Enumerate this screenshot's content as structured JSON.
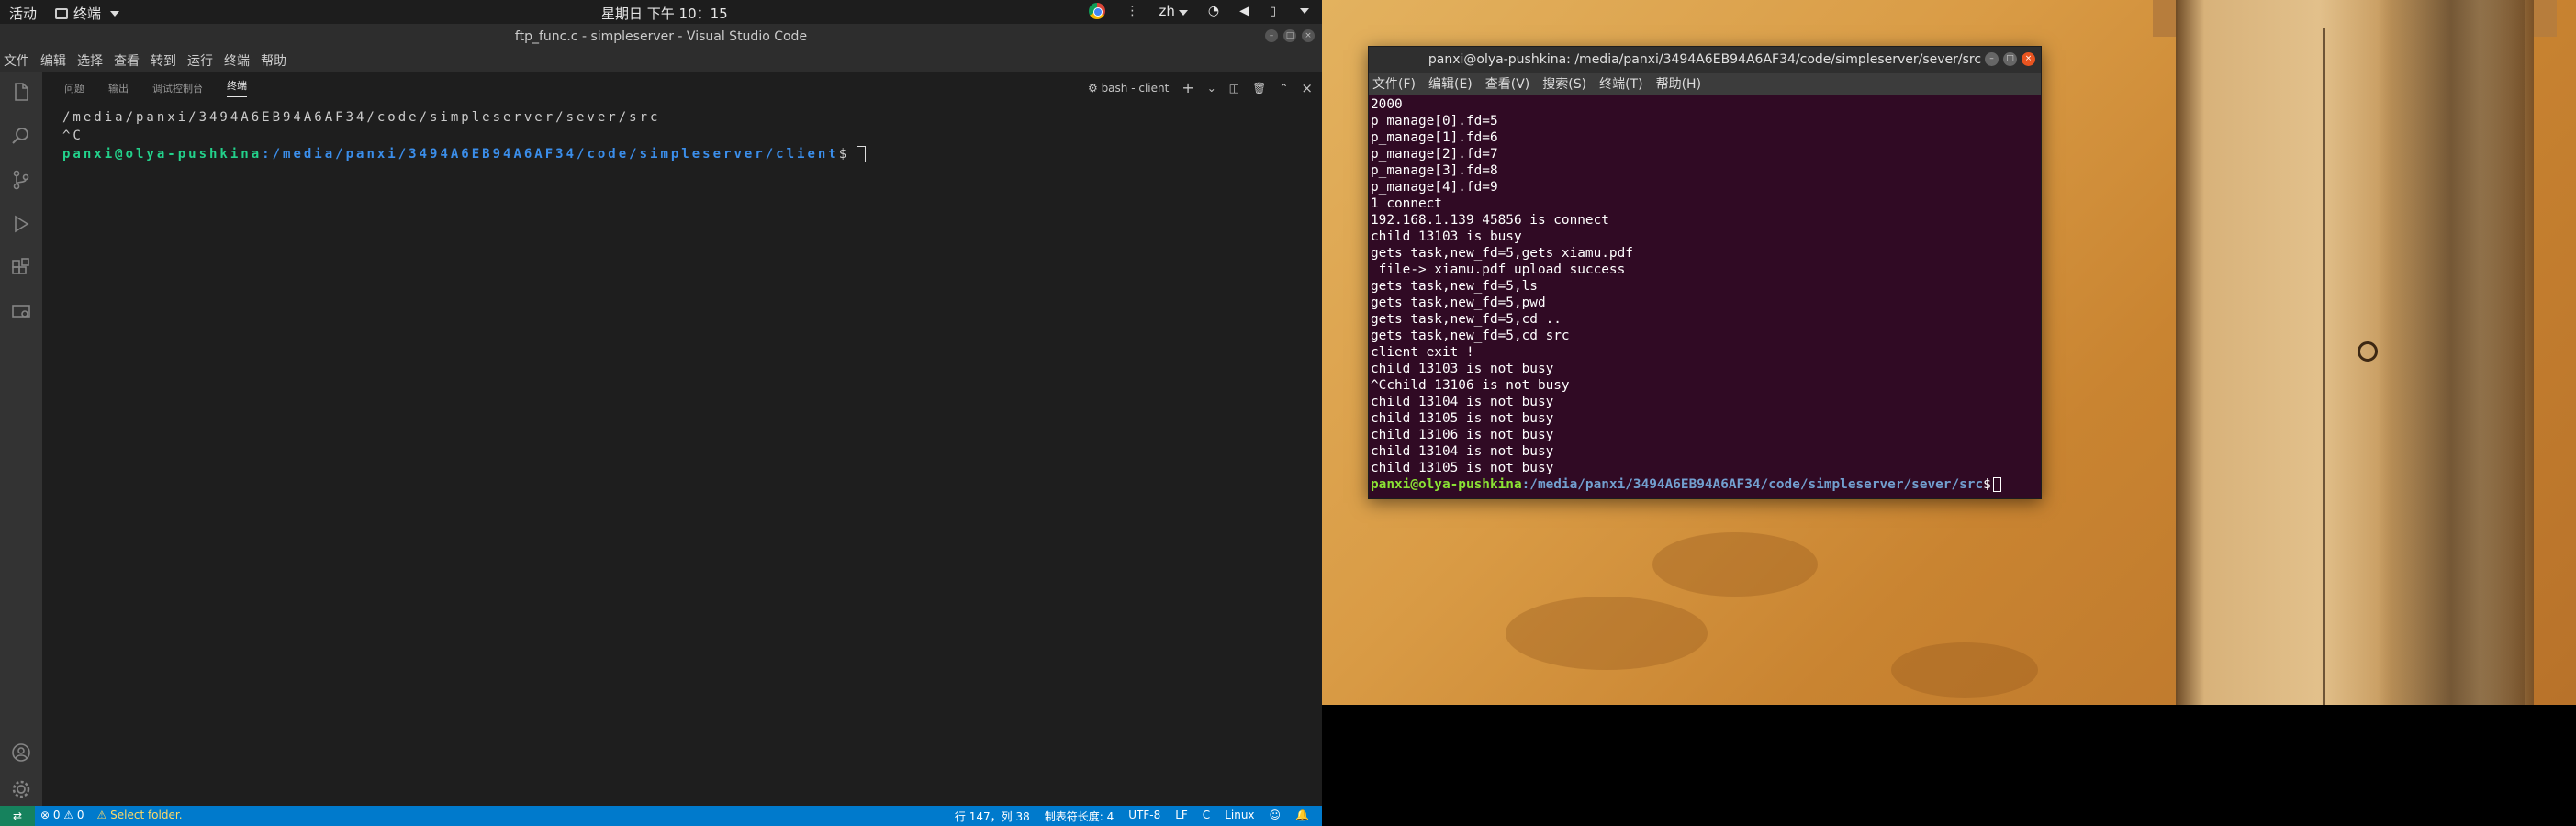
{
  "topbar": {
    "activities": "活动",
    "app_menu": "终端",
    "clock": "星期日 下午 10：15",
    "lang": "zh"
  },
  "vscode": {
    "title": "ftp_func.c - simpleserver - Visual Studio Code",
    "menu": [
      "文件",
      "编辑",
      "选择",
      "查看",
      "转到",
      "运行",
      "终端",
      "帮助"
    ],
    "panel_tabs": [
      "问题",
      "输出",
      "调试控制台",
      "终端"
    ],
    "active_tab": "终端",
    "terminal_selector": "bash - client",
    "terminal_lines": {
      "line1": "/media/panxi/3494A6EB94A6AF34/code/simpleserver/sever/src",
      "line2": "^C",
      "prompt_user": "panxi@olya-pushkina",
      "prompt_path": ":/media/panxi/3494A6EB94A6AF34/code/simpleserver/client",
      "prompt_symbol": "$"
    },
    "status": {
      "errors": "0",
      "warnings": "0",
      "message": "Select folder.",
      "position": "行 147，列 38",
      "tab_size": "制表符长度: 4",
      "encoding": "UTF-8",
      "eol": "LF",
      "language": "C",
      "os": "Linux"
    }
  },
  "gnome_terminal": {
    "title": "panxi@olya-pushkina: /media/panxi/3494A6EB94A6AF34/code/simpleserver/sever/src",
    "menu": [
      "文件(F)",
      "编辑(E)",
      "查看(V)",
      "搜索(S)",
      "终端(T)",
      "帮助(H)"
    ],
    "output": [
      "2000",
      "p_manage[0].fd=5",
      "p_manage[1].fd=6",
      "p_manage[2].fd=7",
      "p_manage[3].fd=8",
      "p_manage[4].fd=9",
      "1 connect",
      "192.168.1.139 45856 is connect",
      "child 13103 is busy",
      "gets task,new_fd=5,gets xiamu.pdf",
      " file-> xiamu.pdf upload success",
      "gets task,new_fd=5,ls",
      "gets task,new_fd=5,pwd",
      "gets task,new_fd=5,cd ..",
      "gets task,new_fd=5,cd src",
      "client exit !",
      "child 13103 is not busy",
      "^Cchild 13106 is not busy",
      "child 13104 is not busy",
      "child 13105 is not busy",
      "child 13106 is not busy",
      "child 13104 is not busy",
      "child 13105 is not busy"
    ],
    "prompt_user": "panxi@olya-pushkina",
    "prompt_path": ":/media/panxi/3494A6EB94A6AF34/code/simpleserver/sever/src",
    "prompt_symbol": "$"
  }
}
